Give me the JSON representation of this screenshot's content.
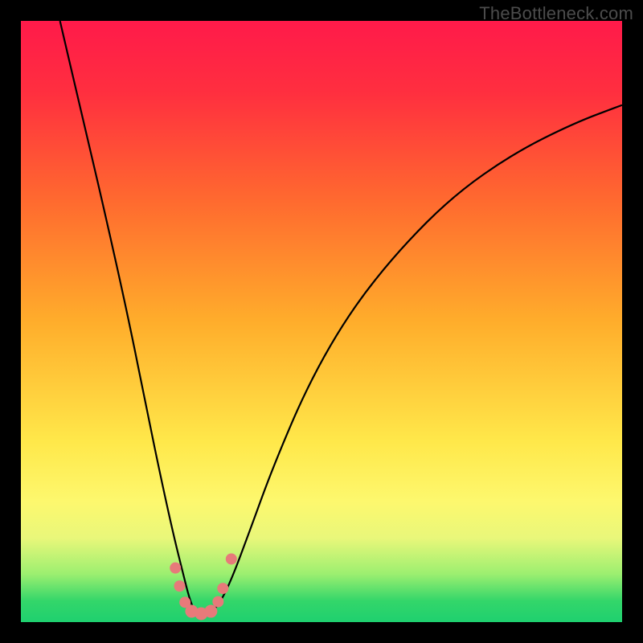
{
  "watermark": "TheBottleneck.com",
  "chart_data": {
    "type": "line",
    "title": "",
    "xlabel": "",
    "ylabel": "",
    "xlim": [
      0,
      100
    ],
    "ylim": [
      0,
      100
    ],
    "gradient_stops": [
      {
        "offset": 0,
        "color": "#ff1a4a"
      },
      {
        "offset": 0.12,
        "color": "#ff2f3f"
      },
      {
        "offset": 0.3,
        "color": "#ff6a2f"
      },
      {
        "offset": 0.5,
        "color": "#ffad2b"
      },
      {
        "offset": 0.7,
        "color": "#ffe84a"
      },
      {
        "offset": 0.8,
        "color": "#fdf86e"
      },
      {
        "offset": 0.86,
        "color": "#e9f77a"
      },
      {
        "offset": 0.92,
        "color": "#9cef70"
      },
      {
        "offset": 0.965,
        "color": "#33d66a"
      },
      {
        "offset": 1.0,
        "color": "#1fd06f"
      }
    ],
    "series": [
      {
        "name": "bottleneck-curve",
        "x": [
          6.5,
          10,
          14,
          18,
          21,
          23.5,
          25.5,
          27,
          28,
          29,
          30,
          31.5,
          33,
          35,
          38,
          42,
          48,
          55,
          63,
          72,
          82,
          92,
          100
        ],
        "y": [
          100,
          85,
          68,
          50,
          35,
          23,
          14,
          8,
          4,
          1.5,
          1.2,
          1.5,
          3,
          7,
          15,
          26,
          40,
          52,
          62,
          71,
          78,
          83,
          86
        ]
      }
    ],
    "markers": {
      "color": "#e77a7a",
      "radius_small": 7,
      "radius_large": 8,
      "points": [
        {
          "x": 25.7,
          "y": 9.0,
          "r": 7
        },
        {
          "x": 26.4,
          "y": 6.0,
          "r": 7
        },
        {
          "x": 27.3,
          "y": 3.3,
          "r": 7
        },
        {
          "x": 28.4,
          "y": 1.8,
          "r": 8
        },
        {
          "x": 30.0,
          "y": 1.4,
          "r": 8
        },
        {
          "x": 31.6,
          "y": 1.8,
          "r": 8
        },
        {
          "x": 32.8,
          "y": 3.4,
          "r": 7
        },
        {
          "x": 33.6,
          "y": 5.6,
          "r": 7
        },
        {
          "x": 35.0,
          "y": 10.5,
          "r": 7
        }
      ]
    }
  }
}
